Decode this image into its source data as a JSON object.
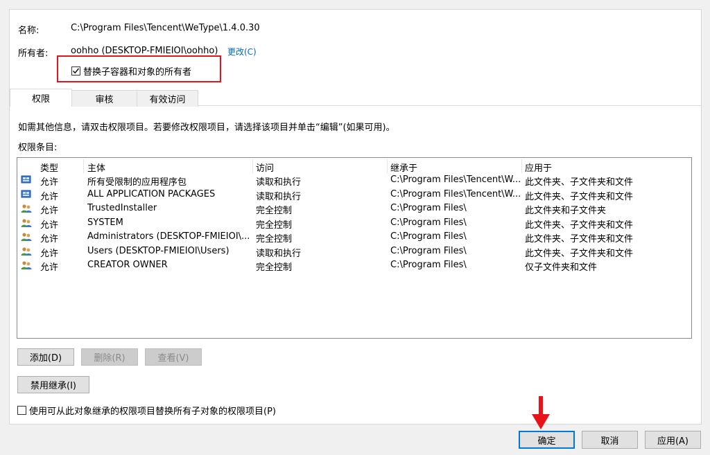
{
  "header": {
    "name_label": "名称:",
    "name_value": "C:\\Program Files\\Tencent\\WeType\\1.4.0.30",
    "owner_label": "所有者:",
    "owner_value": "oohho (DESKTOP-FMIEIOI\\oohho)",
    "change_link": "更改(C)",
    "replace_owner_checkbox": "替换子容器和对象的所有者",
    "replace_owner_checked": true
  },
  "tabs": [
    {
      "label": "权限",
      "active": true
    },
    {
      "label": "审核",
      "active": false
    },
    {
      "label": "有效访问",
      "active": false
    }
  ],
  "info_text": "如需其他信息，请双击权限项目。若要修改权限项目，请选择该项目并单击“编辑”(如果可用)。",
  "entries_label": "权限条目:",
  "table": {
    "columns": [
      "类型",
      "主体",
      "访问",
      "继承于",
      "应用于"
    ],
    "rows": [
      {
        "icon": "app-package-icon",
        "type": "允许",
        "principal": "所有受限制的应用程序包",
        "access": "读取和执行",
        "inherited": "C:\\Program Files\\Tencent\\W...",
        "applies": "此文件夹、子文件夹和文件"
      },
      {
        "icon": "app-package-icon",
        "type": "允许",
        "principal": "ALL APPLICATION PACKAGES",
        "access": "读取和执行",
        "inherited": "C:\\Program Files\\Tencent\\W...",
        "applies": "此文件夹、子文件夹和文件"
      },
      {
        "icon": "user-group-icon",
        "type": "允许",
        "principal": "TrustedInstaller",
        "access": "完全控制",
        "inherited": "C:\\Program Files\\",
        "applies": "此文件夹和子文件夹"
      },
      {
        "icon": "user-group-icon",
        "type": "允许",
        "principal": "SYSTEM",
        "access": "完全控制",
        "inherited": "C:\\Program Files\\",
        "applies": "此文件夹、子文件夹和文件"
      },
      {
        "icon": "user-group-icon",
        "type": "允许",
        "principal": "Administrators (DESKTOP-FMIEIOI\\...",
        "access": "完全控制",
        "inherited": "C:\\Program Files\\",
        "applies": "此文件夹、子文件夹和文件"
      },
      {
        "icon": "user-group-icon",
        "type": "允许",
        "principal": "Users (DESKTOP-FMIEIOI\\Users)",
        "access": "读取和执行",
        "inherited": "C:\\Program Files\\",
        "applies": "此文件夹、子文件夹和文件"
      },
      {
        "icon": "user-group-icon",
        "type": "允许",
        "principal": "CREATOR OWNER",
        "access": "完全控制",
        "inherited": "C:\\Program Files\\",
        "applies": "仅子文件夹和文件"
      }
    ]
  },
  "buttons": {
    "add": "添加(D)",
    "remove": "删除(R)",
    "view": "查看(V)",
    "disable_inheritance": "禁用继承(I)"
  },
  "replace_child_checkbox": "使用可从此对象继承的权限项目替换所有子对象的权限项目(P)",
  "replace_child_checked": false,
  "footer": {
    "ok": "确定",
    "cancel": "取消",
    "apply": "应用(A)"
  },
  "colors": {
    "highlight_box": "#e8121a",
    "arrow": "#e8121a",
    "link": "#0066cc"
  }
}
